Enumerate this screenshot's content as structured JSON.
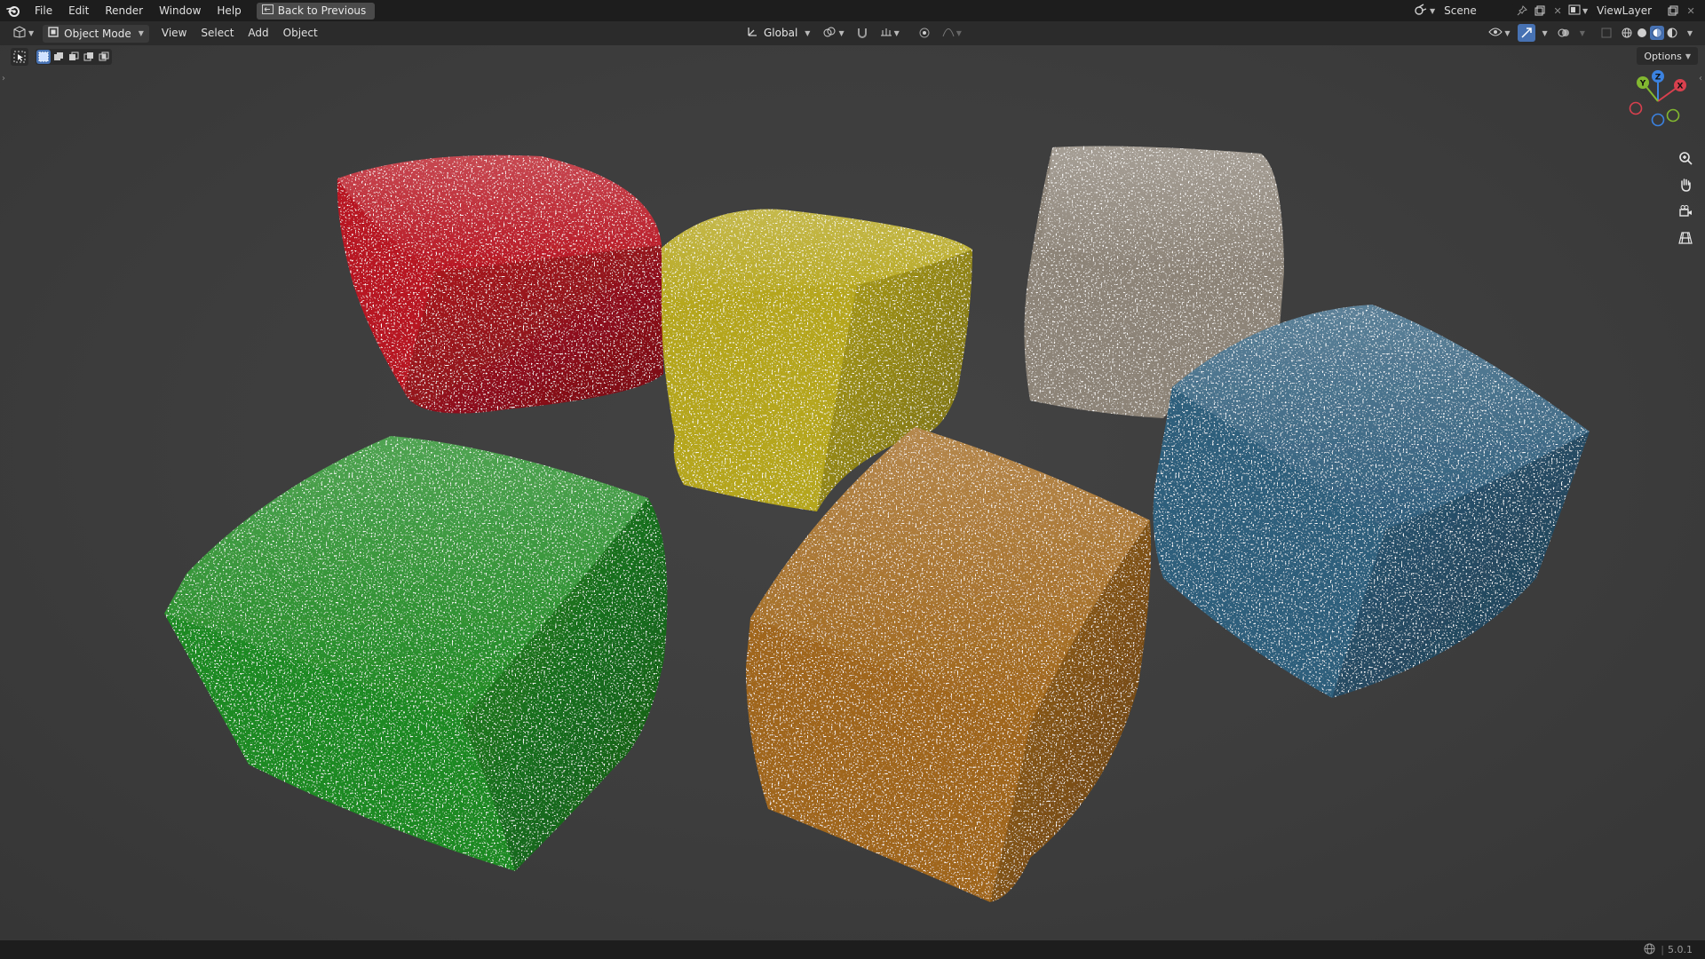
{
  "topbar": {
    "menus": [
      "File",
      "Edit",
      "Render",
      "Window",
      "Help"
    ],
    "back_button": "Back to Previous",
    "scene_name": "Scene",
    "view_layer_name": "ViewLayer"
  },
  "header": {
    "mode": "Object Mode",
    "menus": [
      "View",
      "Select",
      "Add",
      "Object"
    ],
    "transform_orientation": "Global"
  },
  "viewport": {
    "options_label": "Options",
    "gizmo_axes": [
      "X",
      "Y",
      "Z"
    ],
    "objects": [
      {
        "name": "red-cube",
        "color": "#b81622"
      },
      {
        "name": "yellow-cube",
        "color": "#b5a61a"
      },
      {
        "name": "grey-cube",
        "color": "#8d8478"
      },
      {
        "name": "blue-cube",
        "color": "#2f5e7c"
      },
      {
        "name": "green-cube",
        "color": "#1f8a22"
      },
      {
        "name": "orange-cube",
        "color": "#a0661a"
      }
    ]
  },
  "statusbar": {
    "version": "5.0.1"
  },
  "colors": {
    "accent": "#4772b3",
    "axis_x": "#d9404e",
    "axis_y": "#82b830",
    "axis_z": "#3b82e0"
  }
}
